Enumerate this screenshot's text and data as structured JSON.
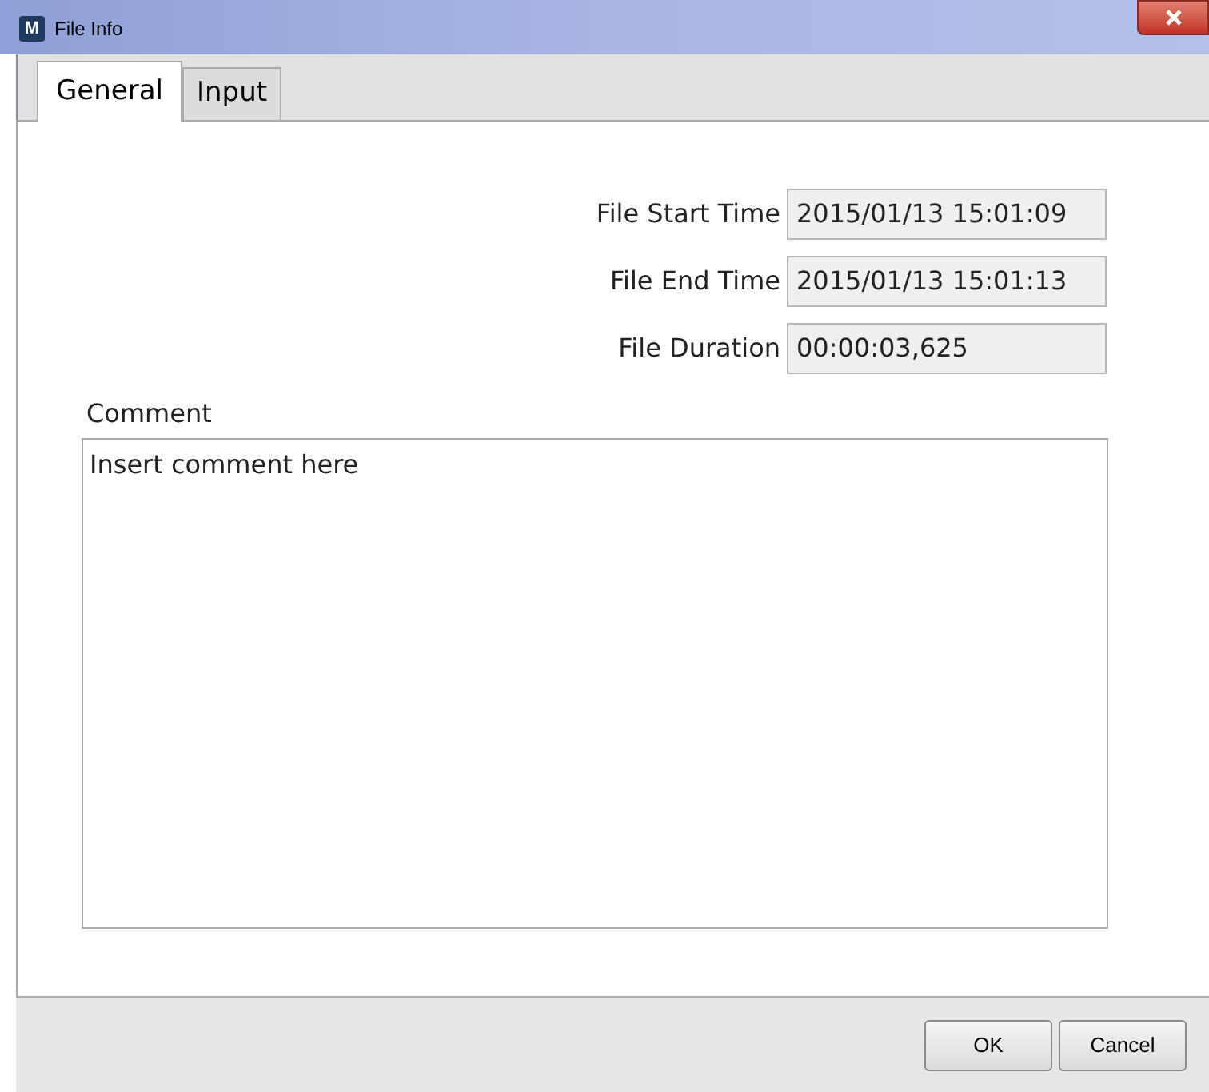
{
  "window": {
    "title": "File Info",
    "app_icon": "M"
  },
  "tabs": [
    {
      "label": "General",
      "selected": true
    },
    {
      "label": "Input",
      "selected": false
    }
  ],
  "fields": [
    {
      "label": "File Start Time",
      "value": "2015/01/13 15:01:09"
    },
    {
      "label": "File End Time",
      "value": "2015/01/13 15:01:13"
    },
    {
      "label": "File Duration",
      "value": "00:00:03,625"
    }
  ],
  "comment": {
    "label": "Comment",
    "value": "Insert comment here"
  },
  "buttons": [
    "OK",
    "Cancel"
  ]
}
